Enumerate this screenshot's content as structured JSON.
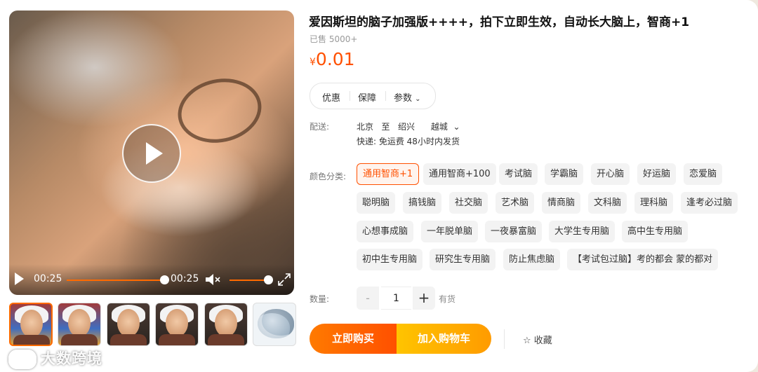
{
  "product": {
    "title": "爱因斯坦的脑子加强版++++，拍下立即生效，自动长大脑上，智商+1",
    "sold": "已售 5000+",
    "currency": "¥",
    "price": "0.01",
    "pills": [
      "优惠",
      "保障",
      "参数"
    ],
    "shipping": {
      "label": "配送:",
      "from": "北京",
      "to_word": "至",
      "city": "绍兴",
      "district": "越城",
      "detail": "快递: 免运费  48小时内发货"
    },
    "color_label": "颜色分类:",
    "options": [
      [
        "通用智商+1",
        "通用智商+100",
        "考试脑",
        "学霸脑",
        "开心脑",
        "好运脑",
        "恋爱脑"
      ],
      [
        "聪明脑",
        "搞钱脑",
        "社交脑",
        "艺术脑",
        "情商脑",
        "文科脑",
        "理科脑",
        "逢考必过脑"
      ],
      [
        "心想事成脑",
        "一年脱单脑",
        "一夜暴富脑",
        "大学生专用脑",
        "高中生专用脑"
      ],
      [
        "初中生专用脑",
        "研究生专用脑",
        "防止焦虑脑",
        "【考试包过脑】考的都会 蒙的都对"
      ]
    ],
    "selected_option": "通用智商+1",
    "quantity_label": "数量:",
    "quantity": "1",
    "stock": "有货",
    "buy_label": "立即购买",
    "cart_label": "加入购物车",
    "fav_label": "☆ 收藏"
  },
  "video": {
    "current_time": "00:25",
    "duration": "00:25",
    "progress": 1.0,
    "volume": 1.0
  },
  "watermark": "大数跨境",
  "colors": {
    "accent": "#ff5000",
    "cart": "#ffa800"
  }
}
